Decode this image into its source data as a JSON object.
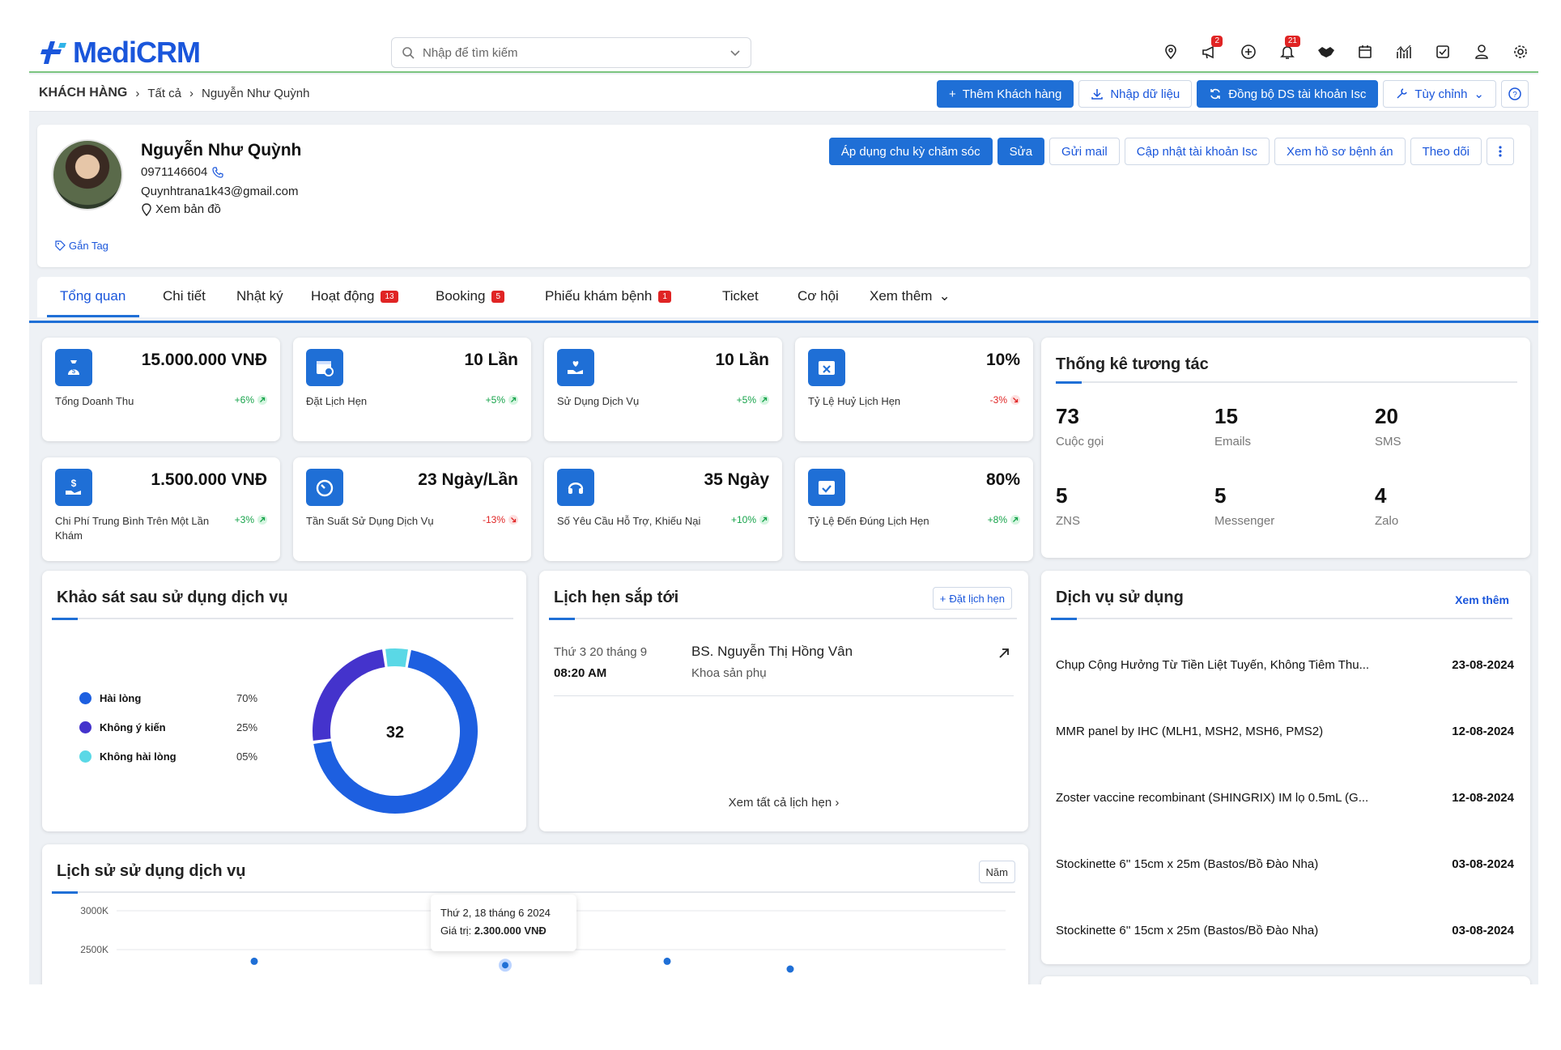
{
  "app": {
    "logo_prefix": "Medi",
    "logo_suffix": "CRM"
  },
  "search": {
    "placeholder": "Nhập để tìm kiếm"
  },
  "topbar": {
    "notifications_megaphone": "2",
    "notifications_bell": "21"
  },
  "breadcrumb": {
    "root": "KHÁCH HÀNG",
    "level1": "Tất cả",
    "level2": "Nguyễn Như Quỳnh"
  },
  "actions": {
    "add_customer": "Thêm Khách hàng",
    "import": "Nhập dữ liệu",
    "sync": "Đồng bộ DS tài khoản Isc",
    "customize": "Tùy chỉnh"
  },
  "profile": {
    "name": "Nguyễn Như Quỳnh",
    "phone": "0971146604",
    "email": "Quynhtrana1k43@gmail.com",
    "map": "Xem bản đồ",
    "tag": "Gắn Tag"
  },
  "profile_actions": {
    "apply_cycle": "Áp dụng chu kỳ chăm sóc",
    "edit": "Sửa",
    "send_mail": "Gửi mail",
    "update_isc": "Cập nhật tài khoản Isc",
    "view_record": "Xem hồ sơ bệnh án",
    "follow": "Theo dõi"
  },
  "tabs": [
    {
      "label": "Tổng quan"
    },
    {
      "label": "Chi tiết"
    },
    {
      "label": "Nhật ký"
    },
    {
      "label": "Hoạt động",
      "badge": "13"
    },
    {
      "label": "Booking",
      "badge": "5"
    },
    {
      "label": "Phiếu khám bệnh",
      "badge": "1"
    },
    {
      "label": "Ticket"
    },
    {
      "label": "Cơ hội"
    },
    {
      "label": "Xem thêm"
    }
  ],
  "kpis": [
    {
      "value": "15.000.000 VNĐ",
      "label": "Tổng Doanh Thu",
      "delta": "+6%",
      "trend": "up",
      "icon": "money-bag-icon"
    },
    {
      "value": "10 Lần",
      "label": "Đặt Lịch Hẹn",
      "delta": "+5%",
      "trend": "up",
      "icon": "calendar-clock-icon"
    },
    {
      "value": "10 Lần",
      "label": "Sử Dụng Dịch Vụ",
      "delta": "+5%",
      "trend": "up",
      "icon": "heart-hand-icon"
    },
    {
      "value": "10%",
      "label": "Tỷ Lệ Huỷ Lịch Hẹn",
      "delta": "-3%",
      "trend": "down",
      "icon": "calendar-x-icon"
    },
    {
      "value": "1.500.000 VNĐ",
      "label": "Chi Phí Trung Bình Trên Một Lần Khám",
      "delta": "+3%",
      "trend": "up",
      "icon": "hand-dollar-icon"
    },
    {
      "value": "23 Ngày/Lần",
      "label": "Tần Suất Sử Dụng Dịch Vụ",
      "delta": "-13%",
      "trend": "down",
      "icon": "timer-icon"
    },
    {
      "value": "35 Ngày",
      "label": "Số Yêu Cầu Hỗ Trợ, Khiếu Nại",
      "delta": "+10%",
      "trend": "up",
      "icon": "headset-icon"
    },
    {
      "value": "80%",
      "label": "Tỷ Lệ Đến Đúng Lịch Hẹn",
      "delta": "+8%",
      "trend": "up",
      "icon": "calendar-check-icon"
    }
  ],
  "interaction": {
    "title": "Thống kê tương tác",
    "stats": [
      {
        "value": "73",
        "label": "Cuộc gọi"
      },
      {
        "value": "15",
        "label": "Emails"
      },
      {
        "value": "20",
        "label": "SMS"
      },
      {
        "value": "5",
        "label": "ZNS"
      },
      {
        "value": "5",
        "label": "Messenger"
      },
      {
        "value": "4",
        "label": "Zalo"
      }
    ]
  },
  "survey": {
    "title": "Khảo sát sau sử dụng dịch vụ",
    "total": "32"
  },
  "appointments": {
    "title": "Lịch hẹn sắp tới",
    "add": "Đặt lịch hẹn",
    "item": {
      "date": "Thứ 3 20 tháng 9",
      "time": "08:20 AM",
      "doctor": "BS. Nguyễn Thị Hồng Vân",
      "dept": "Khoa sản phụ"
    },
    "view_all": "Xem tất cả lịch hẹn"
  },
  "services": {
    "title": "Dịch vụ sử dụng",
    "more": "Xem thêm",
    "items": [
      {
        "name": "Chụp Cộng Hưởng Từ Tiền Liệt Tuyến, Không Tiêm Thu...",
        "date": "23-08-2024"
      },
      {
        "name": "MMR panel by IHC (MLH1, MSH2, MSH6, PMS2)",
        "date": "12-08-2024"
      },
      {
        "name": "Zoster vaccine recombinant (SHINGRIX) IM lọ 0.5mL (G...",
        "date": "12-08-2024"
      },
      {
        "name": "Stockinette 6'' 15cm x 25m (Bastos/Bồ Đào Nha)",
        "date": "03-08-2024"
      },
      {
        "name": "Stockinette 6'' 15cm x 25m (Bastos/Bồ Đào Nha)",
        "date": "03-08-2024"
      }
    ]
  },
  "history": {
    "title": "Lịch sử sử dụng dịch vụ",
    "period": "Năm",
    "tooltip_date": "Thứ 2, 18 tháng 6 2024",
    "tooltip_label": "Giá trị: ",
    "tooltip_value": "2.300.000 VNĐ"
  },
  "chart_data": [
    {
      "type": "pie",
      "title": "Khảo sát sau sử dụng dịch vụ",
      "categories": [
        "Hài lòng",
        "Không ý kiến",
        "Không hài lòng"
      ],
      "values": [
        70,
        25,
        5
      ],
      "labels": [
        "70%",
        "25%",
        "05%"
      ],
      "colors": [
        "#1d5fe0",
        "#4433cc",
        "#5ad8e6"
      ],
      "center_label": "32"
    },
    {
      "type": "scatter",
      "title": "Lịch sử sử dụng dịch vụ",
      "ytick_labels": [
        "3000K",
        "2500K"
      ],
      "ylim": [
        2300,
        3000
      ],
      "points": [
        {
          "x": 1,
          "y": 2350
        },
        {
          "x": 2,
          "y": 2300
        },
        {
          "x": 3,
          "y": 2350
        },
        {
          "x": 4,
          "y": 2250
        }
      ]
    }
  ]
}
